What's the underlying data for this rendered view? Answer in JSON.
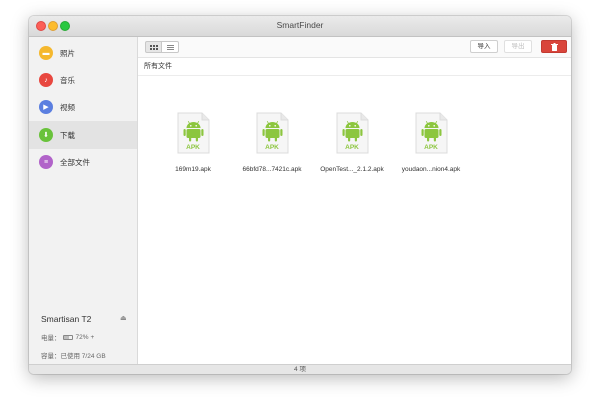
{
  "window": {
    "title": "SmartFinder"
  },
  "sidebar": {
    "items": [
      {
        "label": "照片",
        "icon": "photo-icon",
        "color": "#f5b82e",
        "glyph": "▬"
      },
      {
        "label": "音乐",
        "icon": "music-icon",
        "color": "#e8473f",
        "glyph": "♪"
      },
      {
        "label": "视频",
        "icon": "video-icon",
        "color": "#5b7fe0",
        "glyph": "▶"
      },
      {
        "label": "下载",
        "icon": "download-icon",
        "color": "#69c23b",
        "glyph": "⬇"
      },
      {
        "label": "全部文件",
        "icon": "files-icon",
        "color": "#b163c9",
        "glyph": "≡"
      }
    ],
    "active_index": 3,
    "device": {
      "name": "Smartisan T2",
      "battery_label": "电量：",
      "battery_percent": "72%",
      "battery_level": 0.72,
      "charging_symbol": "+",
      "storage": "容量：已使用 7/24 GB"
    }
  },
  "toolbar": {
    "import_label": "导入",
    "export_label": "导出",
    "delete_icon": "trash-icon",
    "delete_color": "#d9453b"
  },
  "breadcrumb": "所有文件",
  "files": [
    {
      "name": "169m19.apk",
      "badge": "APK"
    },
    {
      "name": "66bfd78...7421c.apk",
      "badge": "APK"
    },
    {
      "name": "OpenTest..._2.1.2.apk",
      "badge": "APK"
    },
    {
      "name": "youdaon...nion4.apk",
      "badge": "APK"
    }
  ],
  "status": {
    "count": "4 项"
  },
  "colors": {
    "android_green": "#8cc63f"
  }
}
